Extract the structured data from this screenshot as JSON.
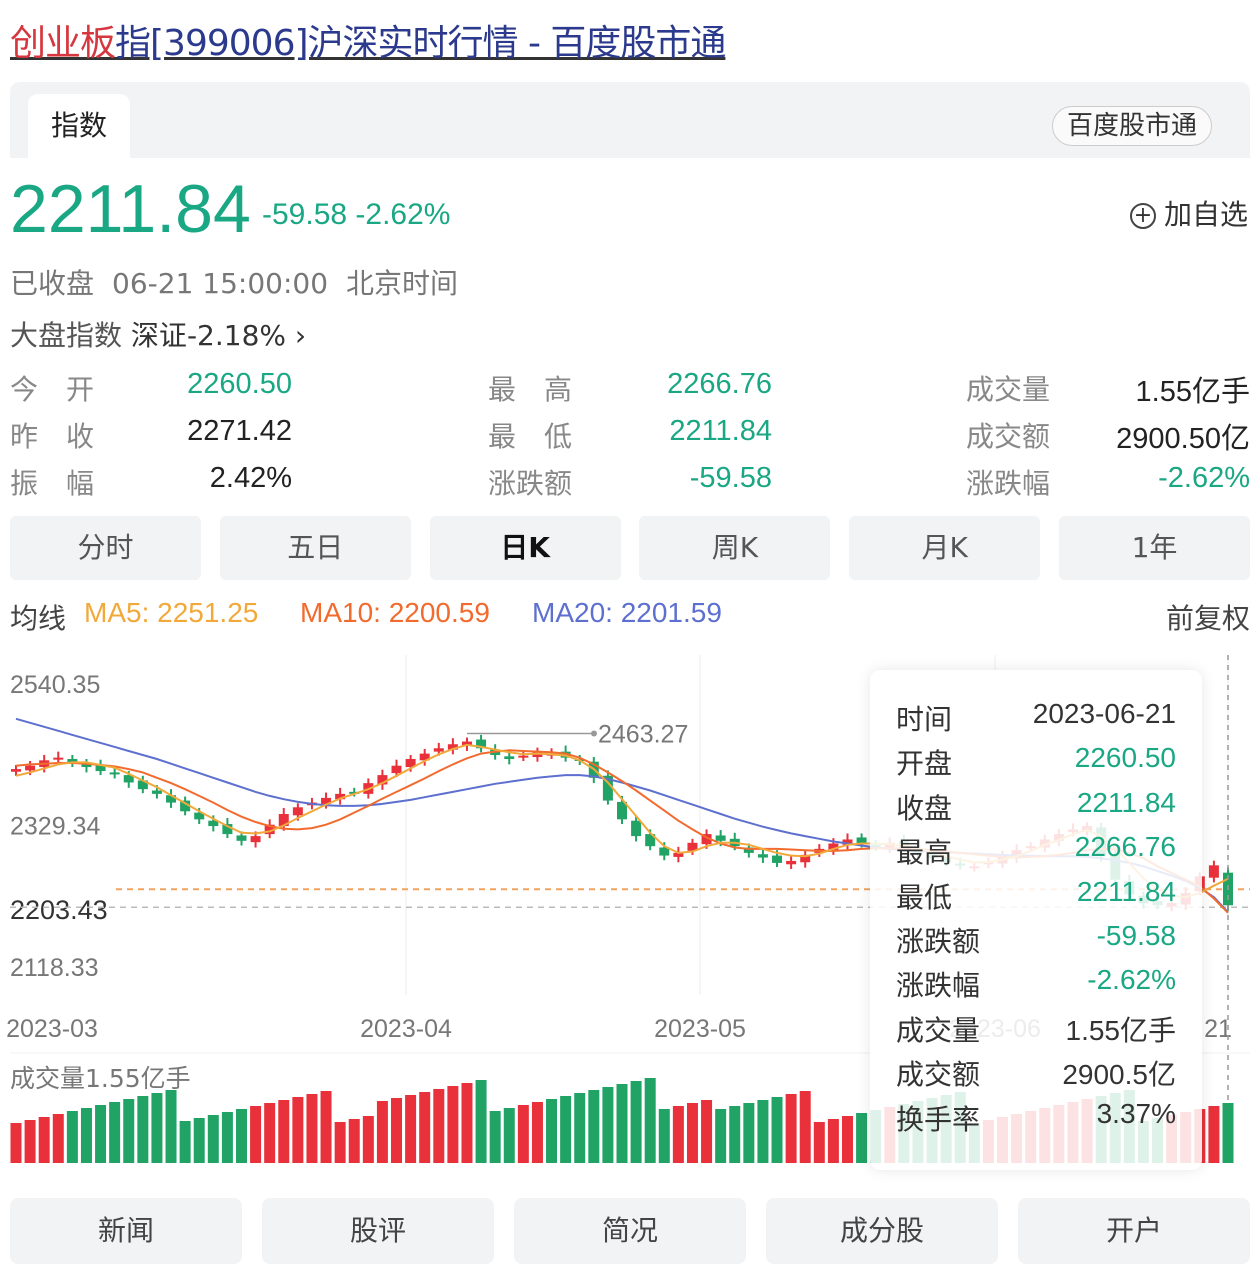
{
  "title": {
    "part1": "创业板",
    "part2": "指[399006]沪深实时行情 - 百度股市通"
  },
  "tabs": {
    "active": "指数",
    "badge": "百度股市通"
  },
  "quote": {
    "price": "2211.84",
    "change": "-59.58",
    "change_pct": "-2.62%",
    "add_fav": "加自选"
  },
  "status": {
    "state": "已收盘",
    "time": "06-21 15:00:00",
    "zone": "北京时间"
  },
  "market": {
    "label": "大盘指数",
    "name": "深证",
    "pct": "-2.18%",
    "arrow": "›"
  },
  "stats": [
    {
      "label": "今　开",
      "value": "2260.50",
      "color": "green"
    },
    {
      "label": "最　高",
      "value": "2266.76",
      "color": "green"
    },
    {
      "label": "成交量",
      "value": "1.55亿手",
      "color": "black"
    },
    {
      "label": "昨　收",
      "value": "2271.42",
      "color": "black"
    },
    {
      "label": "最　低",
      "value": "2211.84",
      "color": "green"
    },
    {
      "label": "成交额",
      "value": "2900.50亿",
      "color": "black"
    },
    {
      "label": "振　幅",
      "value": "2.42%",
      "color": "black"
    },
    {
      "label": "涨跌额",
      "value": "-59.58",
      "color": "green"
    },
    {
      "label": "涨跌幅",
      "value": "-2.62%",
      "color": "green"
    }
  ],
  "periods": [
    "分时",
    "五日",
    "日K",
    "周K",
    "月K",
    "1年"
  ],
  "active_period": "日K",
  "ma": {
    "label": "均线",
    "ma5": "MA5: 2251.25",
    "ma10": "MA10: 2200.59",
    "ma20": "MA20: 2201.59",
    "adjust": "前复权"
  },
  "tooltip": [
    {
      "k": "时间",
      "v": "2023-06-21",
      "g": false
    },
    {
      "k": "开盘",
      "v": "2260.50",
      "g": true
    },
    {
      "k": "收盘",
      "v": "2211.84",
      "g": true
    },
    {
      "k": "最高",
      "v": "2266.76",
      "g": true
    },
    {
      "k": "最低",
      "v": "2211.84",
      "g": true
    },
    {
      "k": "涨跌额",
      "v": "-59.58",
      "g": true
    },
    {
      "k": "涨跌幅",
      "v": "-2.62%",
      "g": true
    },
    {
      "k": "成交量",
      "v": "1.55亿手",
      "g": false
    },
    {
      "k": "成交额",
      "v": "2900.5亿",
      "g": false
    },
    {
      "k": "换手率",
      "v": "3.37%",
      "g": false
    }
  ],
  "bottom_nav": [
    "新闻",
    "股评",
    "简况",
    "成分股",
    "开户"
  ],
  "colors": {
    "up": "#e8313b",
    "down": "#21a366",
    "ma5": "#f2a93b",
    "ma10": "#f26b2e",
    "ma20": "#5d6fcf",
    "accent": "#1aa784"
  },
  "chart_data": {
    "type": "candlestick",
    "y_ticks": [
      "2540.35",
      "2329.34",
      "2203.43",
      "2118.33"
    ],
    "y_range": [
      2118.33,
      2540.35
    ],
    "x_labels": [
      "2023-03",
      "2023-04",
      "2023-05",
      "2023-06",
      "21"
    ],
    "max_annotation": "2463.27",
    "current_price": 2211.84,
    "volume_label": "成交量1.55亿手",
    "closes": [
      2415,
      2420,
      2428,
      2432,
      2425,
      2418,
      2412,
      2408,
      2395,
      2385,
      2378,
      2365,
      2352,
      2340,
      2330,
      2318,
      2308,
      2315,
      2332,
      2348,
      2358,
      2365,
      2372,
      2378,
      2380,
      2394,
      2406,
      2420,
      2430,
      2438,
      2446,
      2452,
      2456,
      2446,
      2436,
      2430,
      2435,
      2440,
      2438,
      2432,
      2428,
      2402,
      2368,
      2340,
      2315,
      2300,
      2286,
      2290,
      2305,
      2318,
      2308,
      2300,
      2290,
      2283,
      2275,
      2278,
      2287,
      2296,
      2304,
      2310,
      2304,
      2300,
      2305,
      2298,
      2290,
      2282,
      2276,
      2272,
      2270,
      2276,
      2285,
      2294,
      2300,
      2310,
      2318,
      2325,
      2330,
      2285,
      2250,
      2228,
      2215,
      2212,
      2215,
      2230,
      2255,
      2271.42,
      2211.84
    ],
    "ma5": [
      2405,
      2410,
      2416,
      2422,
      2425,
      2425,
      2421,
      2417,
      2408,
      2398,
      2388,
      2376,
      2364,
      2352,
      2341,
      2330,
      2320,
      2319,
      2322,
      2331,
      2342,
      2352,
      2362,
      2371,
      2378,
      2385,
      2394,
      2405,
      2416,
      2427,
      2437,
      2445,
      2451,
      2448,
      2444,
      2440,
      2437,
      2438,
      2437,
      2435,
      2428,
      2415,
      2395,
      2370,
      2345,
      2320,
      2300,
      2290,
      2292,
      2300,
      2305,
      2305,
      2302,
      2296,
      2290,
      2286,
      2285,
      2289,
      2296,
      2302,
      2304,
      2304,
      2303,
      2301,
      2297,
      2291,
      2285,
      2280,
      2276,
      2276,
      2280,
      2285,
      2293,
      2302,
      2309,
      2318,
      2324,
      2315,
      2297,
      2275,
      2252,
      2236,
      2226,
      2224,
      2230,
      2241,
      2251.25
    ],
    "ma10": [
      2420,
      2422,
      2423,
      2424,
      2424,
      2423,
      2421,
      2419,
      2415,
      2410,
      2402,
      2394,
      2385,
      2375,
      2365,
      2354,
      2344,
      2336,
      2330,
      2326,
      2325,
      2327,
      2332,
      2340,
      2350,
      2360,
      2371,
      2381,
      2391,
      2401,
      2412,
      2422,
      2431,
      2438,
      2441,
      2443,
      2442,
      2441,
      2440,
      2438,
      2432,
      2422,
      2410,
      2397,
      2383,
      2368,
      2353,
      2338,
      2325,
      2313,
      2304,
      2298,
      2296,
      2296,
      2296,
      2295,
      2294,
      2293,
      2293,
      2294,
      2296,
      2297,
      2297,
      2297,
      2296,
      2294,
      2292,
      2290,
      2288,
      2286,
      2284,
      2283,
      2284,
      2285,
      2287,
      2290,
      2294,
      2296,
      2295,
      2290,
      2282,
      2270,
      2260,
      2250,
      2240,
      2222,
      2200.59
    ],
    "ma20": [
      2490,
      2484,
      2478,
      2472,
      2466,
      2460,
      2454,
      2448,
      2442,
      2436,
      2430,
      2423,
      2416,
      2409,
      2402,
      2395,
      2388,
      2381,
      2375,
      2370,
      2366,
      2363,
      2361,
      2360,
      2360,
      2361,
      2363,
      2366,
      2369,
      2373,
      2377,
      2381,
      2385,
      2389,
      2393,
      2396,
      2399,
      2402,
      2404,
      2406,
      2406,
      2404,
      2400,
      2395,
      2389,
      2383,
      2376,
      2369,
      2362,
      2355,
      2348,
      2341,
      2335,
      2329,
      2324,
      2319,
      2315,
      2311,
      2307,
      2304,
      2301,
      2298,
      2296,
      2294,
      2293,
      2292,
      2291,
      2290,
      2289,
      2288,
      2287,
      2286,
      2286,
      2285,
      2285,
      2285,
      2284,
      2282,
      2279,
      2275,
      2270,
      2263,
      2256,
      2248,
      2238,
      2224,
      2201.59
    ]
  }
}
